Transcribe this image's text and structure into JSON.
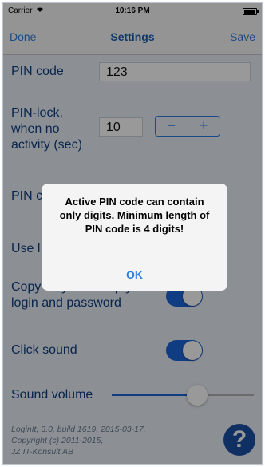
{
  "status_bar": {
    "carrier": "Carrier",
    "time": "10:16 PM",
    "battery_level": 0.9
  },
  "nav": {
    "left": "Done",
    "title": "Settings",
    "right": "Save"
  },
  "pin_code": {
    "label": "PIN code",
    "value": "123"
  },
  "pin_lock": {
    "label_line1": "PIN-lock,",
    "label_line2": "when no",
    "label_line3": "activity (sec)",
    "value": "10",
    "minus": "−",
    "plus": "+"
  },
  "hidden_row_1": {
    "label": "PIN c"
  },
  "hidden_row_2": {
    "label": "Use l"
  },
  "copy_login": {
    "label_line1": "Copy only non-empty",
    "label_line2": "login and password",
    "enabled": true
  },
  "click_sound": {
    "label": "Click sound",
    "enabled": true
  },
  "sound_volume": {
    "label": "Sound volume",
    "level": 0.6
  },
  "footer": {
    "line1": "LoginIt, 3.0, build 1619, 2015-03-17.",
    "line2": "Copyright (c) 2011-2015,",
    "line3": "JZ IT-Konsult AB"
  },
  "help": {
    "glyph": "?"
  },
  "alert": {
    "line1": "Active PIN code can contain",
    "line2": "only digits. Minimum length of",
    "line3": "PIN code is 4 digits!",
    "button": "OK"
  },
  "colors": {
    "accent": "#2a7de1",
    "toggle_on": "#1c64d8",
    "label": "#0f3f80",
    "background": "#e9f0f8"
  }
}
